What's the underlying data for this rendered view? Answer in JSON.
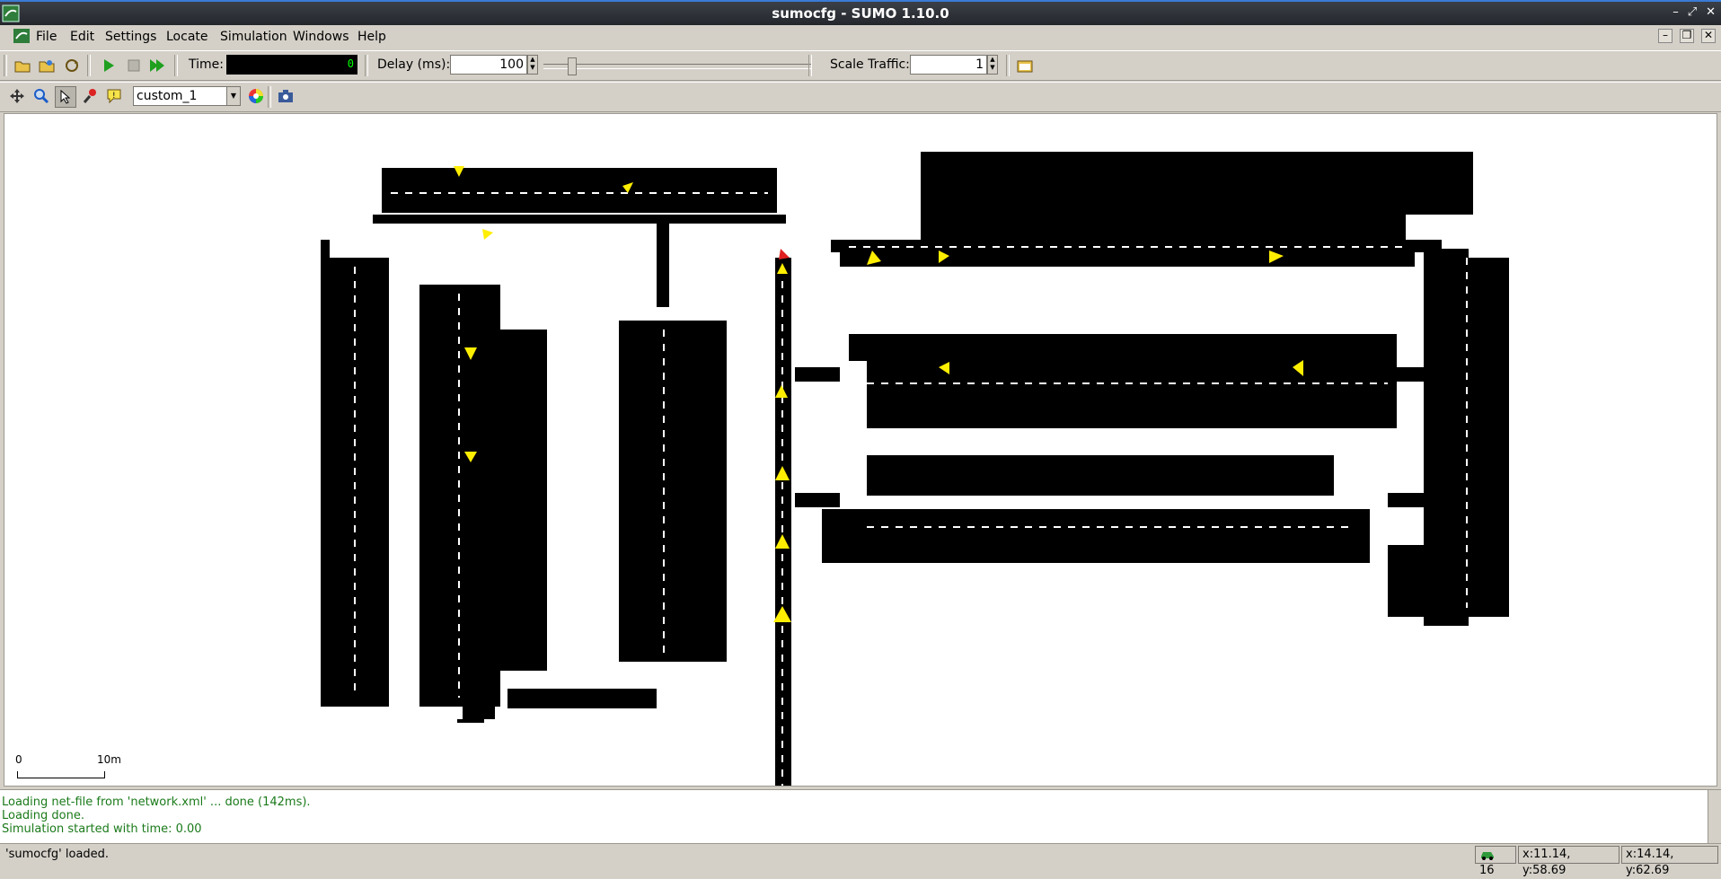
{
  "window": {
    "title": "sumocfg - SUMO 1.10.0",
    "controls": [
      "–",
      "⤢",
      "✕"
    ]
  },
  "menu": {
    "items": [
      {
        "label": "File",
        "key": "F"
      },
      {
        "label": "Edit",
        "key": "E"
      },
      {
        "label": "Settings",
        "key": "S"
      },
      {
        "label": "Locate",
        "key": "L"
      },
      {
        "label": "Simulation",
        "key": ""
      },
      {
        "label": "Windows",
        "key": "W"
      },
      {
        "label": "Help",
        "key": "H"
      }
    ]
  },
  "toolbar": {
    "time_label": "Time:",
    "time_value": "0",
    "delay_label": "Delay (ms):",
    "delay_value": "100",
    "scale_label": "Scale Traffic:",
    "scale_value": "1"
  },
  "viewbar": {
    "scheme_value": "custom_1"
  },
  "canvas": {
    "scale_start": "0",
    "scale_end": "10m"
  },
  "log": {
    "lines": [
      "Loading net-file from 'network.xml' ... done (142ms).",
      "Loading done.",
      "Simulation started with time: 0.00"
    ]
  },
  "status": {
    "message": "'sumocfg' loaded.",
    "vehicle_count": "16",
    "coord1": "x:11.14, y:58.69",
    "coord2": "x:14.14, y:62.69"
  },
  "colors": {
    "accent": "#3a7bd5",
    "log_text": "#1a7a1a",
    "vehicle": "#ffee00",
    "vehicle_red": "#e02020"
  }
}
